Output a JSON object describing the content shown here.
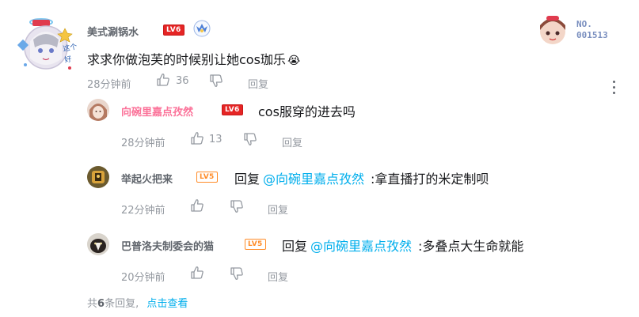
{
  "main_comment": {
    "username": "美式涮锅水",
    "level": "LV6",
    "text": "求求你做泡芙的时候别让她cos珈乐",
    "emoji": "😭",
    "time": "28分钟前",
    "likes": "36",
    "reply_label": "回复",
    "badge_no": "NO.",
    "badge_num": "001513"
  },
  "replies": [
    {
      "username": "向碗里嘉点孜然",
      "level": "LV6",
      "reply_prefix": "",
      "mention": "",
      "text": "cos服穿的进去吗",
      "time": "28分钟前",
      "likes": "13",
      "reply_label": "回复"
    },
    {
      "username": "举起火把来",
      "level": "LV5",
      "reply_prefix": "回复",
      "mention": "@向碗里嘉点孜然",
      "text": ":拿直播打的米定制呗",
      "time": "22分钟前",
      "likes": "",
      "reply_label": "回复"
    },
    {
      "username": "巴普洛夫制委会的猫",
      "level": "LV5",
      "reply_prefix": "回复",
      "mention": "@向碗里嘉点孜然",
      "text": ":多叠点大生命就能",
      "time": "20分钟前",
      "likes": "",
      "reply_label": "回复"
    }
  ],
  "footer": {
    "total_prefix": "共",
    "total_count": "6",
    "total_suffix": "条回复,",
    "view_link": "点击查看"
  },
  "colors": {
    "accent": "#00aeec",
    "pink_name": "#fb7299",
    "level6": "#e52525",
    "level5": "#ff8c28"
  }
}
